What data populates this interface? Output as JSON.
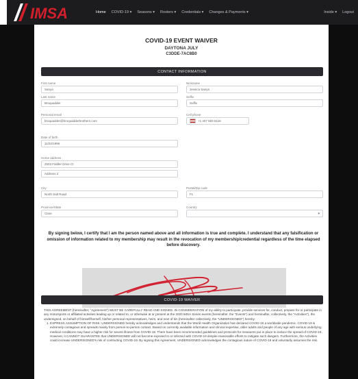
{
  "nav": {
    "brand": "IMSA",
    "links": [
      "Home",
      "COVID-19 ▾",
      "Seasons ▾",
      "Rosters ▾",
      "Credentials ▾",
      "Changes & Payments ▾"
    ],
    "right_links": [
      "Inside ▾",
      "Logout"
    ]
  },
  "title": {
    "heading": "COVID-19 EVENT WAIVER",
    "event": "DAYTONA JULY",
    "event_code": "C3DDE-7AC8B0"
  },
  "contact": {
    "section_label": "CONTACT INFORMATION",
    "first_name_label": "First name",
    "first_name_value": "Sanya",
    "nickname_label": "Nickname",
    "nickname_value": "Jessica Sanya",
    "last_name_label": "Last name",
    "last_name_value": "Broquadder",
    "suffix_label": "Suffix",
    "suffix_value": "Suffix",
    "email_label": "Personal email",
    "email_value": "broquadder@broquadderbrothers.com",
    "phone_label": "Cell phone",
    "phone_value": "+1 407 583 6116",
    "birth_label": "Date of birth",
    "birth_value": "11/22/1999",
    "address_label": "Home address",
    "address1_value": "2503 Fiddler Drive Ct",
    "address2_value": "Address 2",
    "city_label": "City",
    "city_value": "North Salt Road",
    "postal_label": "Postal/Zip code",
    "postal_value": "FL",
    "province_label": "Province/State",
    "province_value": "Clare",
    "country_label": "Country",
    "country_value": ""
  },
  "statement": "By signing below, I certify that I am the person named above and all information is true and complete. I understand that any falsification or omission of information related to my membership may result in the revocation of my membership/credential regardless of the time elapsed before discovery.",
  "waiver": {
    "section_label": "COVID-19 WAIVER",
    "intro": "THIS AGREEMENT (hereinafter, \"Agreement\") MUST BE CAREFULLY READ AND SIGNED. IN CONSIDERATION of my ability to participate, provide services for, conduct, prepare for or participate in any motorsports or affiliated activities leading up or related to, or otherwise at or present at the 2020 IMSA Series events (hereinafter, the \"Events\") and hereinafter, collectively, the \"Activities\"), the undersigned, on behalf of himself/herself, his/her personal representatives, heirs, and next of kin (hereinafter collectively, the \"UNDERSIGNED\") hereby:",
    "item1": "EXPRESS ASSUMPTION OF RISK: UNDERSIGNED hereby acknowledges and understands that the World Health Organization has declared COVID-19 a worldwide pandemic. COVID-19 is extremely contagious and spreads mainly from person-to-person contact. Based on currently available information and clinical expertise, older adults and people of any age with serious underlying medical conditions may have a higher risk for severe illness from COVID-19. There have been recommended guidelines and protocols for measures put in place to reduce the spread of COVID-19. However, it CANNOT GUARANTEE that UNDERSIGNED will not become exposed to or infected with COVID-19 despite reasonable efforts to mitigate such dangers. Furthermore, the Activities could increase UNDERSIGNED's risk of contracting COVID-19. By signing this Agreement, UNDERSIGNED acknowledges the contagious nature of COVID-19 and voluntarily assumes the risk."
  }
}
